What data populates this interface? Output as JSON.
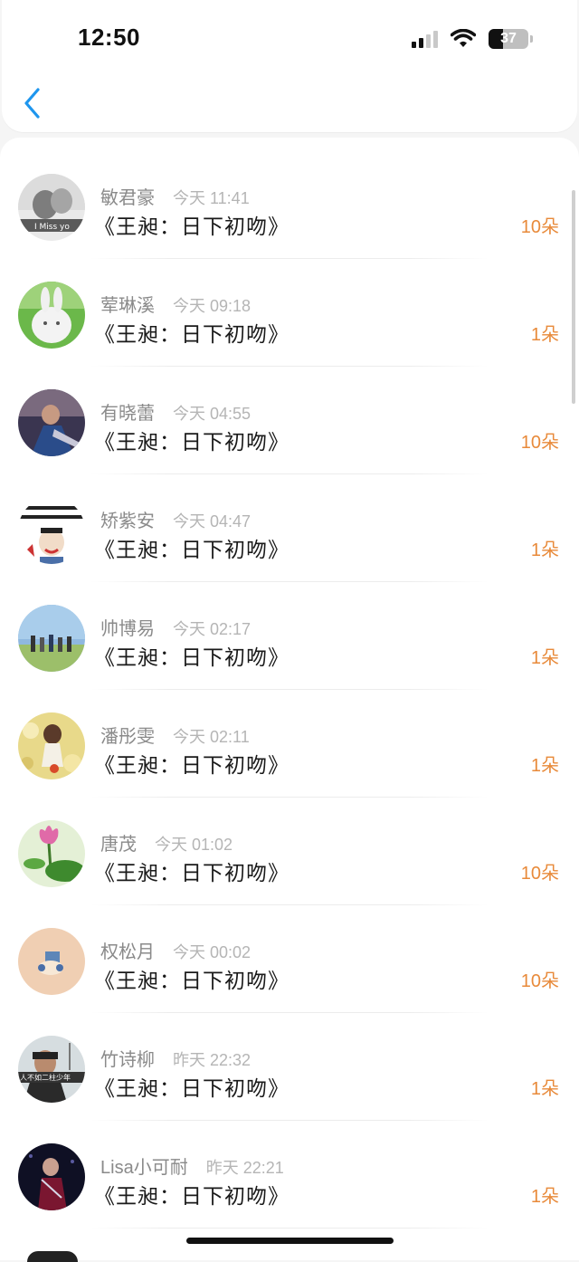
{
  "status_bar": {
    "time": "12:50",
    "battery": "37"
  },
  "header": {
    "back_icon": "chevron-left-icon",
    "accent_color": "#1e96ee"
  },
  "colors": {
    "amount": "#e88a3a",
    "name": "#8a8a8a",
    "timestamp": "#b5b5b5",
    "title": "#1a1a1a"
  },
  "list": [
    {
      "name": "敏君豪",
      "time": "今天 11:41",
      "title": "《王昶：日下初吻》",
      "amount": "10朵"
    },
    {
      "name": "荤琳溪",
      "time": "今天 09:18",
      "title": "《王昶：日下初吻》",
      "amount": "1朵"
    },
    {
      "name": "有晓蕾",
      "time": "今天 04:55",
      "title": "《王昶：日下初吻》",
      "amount": "10朵"
    },
    {
      "name": "矫紫安",
      "time": "今天 04:47",
      "title": "《王昶：日下初吻》",
      "amount": "1朵"
    },
    {
      "name": "帅博易",
      "time": "今天 02:17",
      "title": "《王昶：日下初吻》",
      "amount": "1朵"
    },
    {
      "name": "潘彤雯",
      "time": "今天 02:11",
      "title": "《王昶：日下初吻》",
      "amount": "1朵"
    },
    {
      "name": "唐茂",
      "time": "今天 01:02",
      "title": "《王昶：日下初吻》",
      "amount": "10朵"
    },
    {
      "name": "权松月",
      "time": "今天 00:02",
      "title": "《王昶：日下初吻》",
      "amount": "10朵"
    },
    {
      "name": "竹诗柳",
      "time": "昨天 22:32",
      "title": "《王昶：日下初吻》",
      "amount": "1朵"
    },
    {
      "name": "Lisa小可耐",
      "time": "昨天 22:21",
      "title": "《王昶：日下初吻》",
      "amount": "1朵"
    }
  ]
}
